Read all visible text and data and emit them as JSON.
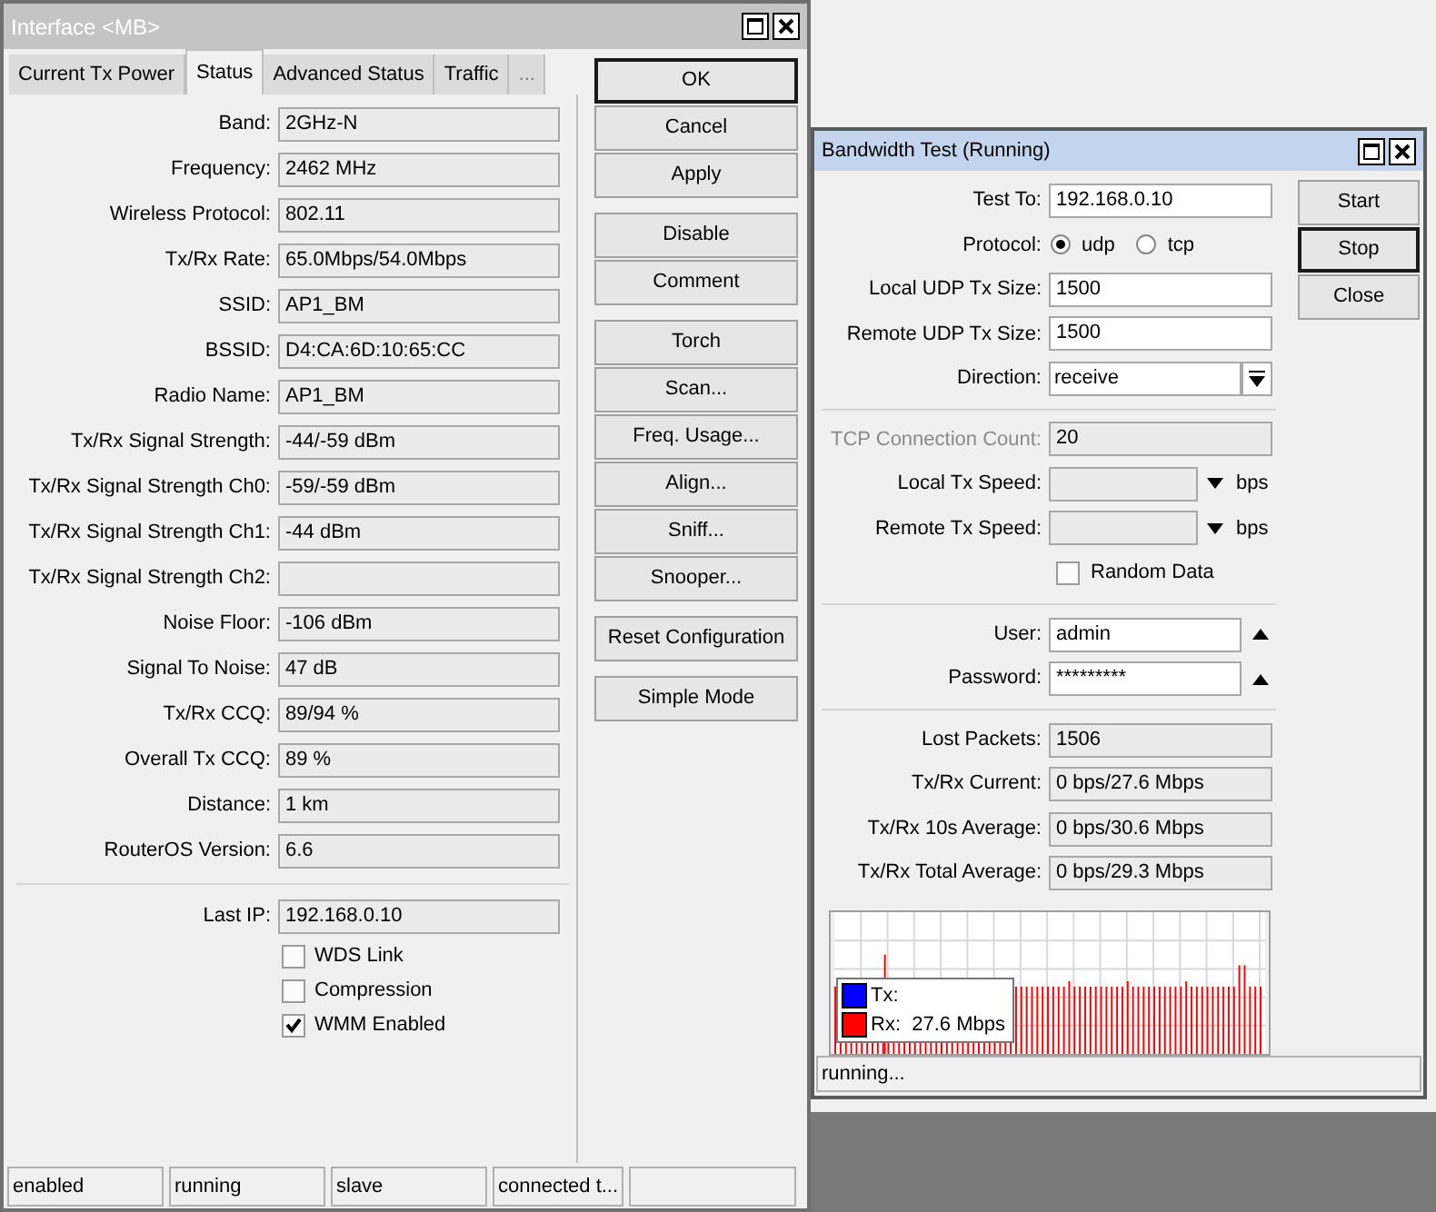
{
  "interface_window": {
    "title": "Interface <MB>",
    "tabs": [
      {
        "label": "Current Tx Power",
        "selected": false
      },
      {
        "label": "Status",
        "selected": true
      },
      {
        "label": "Advanced Status",
        "selected": false
      },
      {
        "label": "Traffic",
        "selected": false
      },
      {
        "label": "...",
        "selected": false
      }
    ],
    "fields": [
      {
        "label": "Band:",
        "value": "2GHz-N"
      },
      {
        "label": "Frequency:",
        "value": "2462 MHz"
      },
      {
        "label": "Wireless Protocol:",
        "value": "802.11"
      },
      {
        "label": "Tx/Rx Rate:",
        "value": "65.0Mbps/54.0Mbps"
      },
      {
        "label": "SSID:",
        "value": "AP1_BM"
      },
      {
        "label": "BSSID:",
        "value": "D4:CA:6D:10:65:CC"
      },
      {
        "label": "Radio Name:",
        "value": "AP1_BM"
      },
      {
        "label": "Tx/Rx Signal Strength:",
        "value": "-44/-59 dBm"
      },
      {
        "label": "Tx/Rx Signal Strength Ch0:",
        "value": "-59/-59 dBm"
      },
      {
        "label": "Tx/Rx Signal Strength Ch1:",
        "value": "-44 dBm"
      },
      {
        "label": "Tx/Rx Signal Strength Ch2:"
      },
      {
        "label": "Noise Floor:",
        "value": "-106 dBm"
      },
      {
        "label": "Signal To Noise:",
        "value": "47 dB"
      },
      {
        "label": "Tx/Rx CCQ:",
        "value": "89/94 %"
      },
      {
        "label": "Overall Tx CCQ:",
        "value": "89 %"
      },
      {
        "label": "Distance:",
        "value": "1 km"
      },
      {
        "label": "RouterOS Version:",
        "value": "6.6"
      }
    ],
    "last_ip": {
      "label": "Last IP:",
      "value": "192.168.0.10"
    },
    "checkboxes": [
      {
        "label": "WDS Link",
        "checked": false
      },
      {
        "label": "Compression",
        "checked": false
      },
      {
        "label": "WMM Enabled",
        "checked": true
      }
    ],
    "button_groups": [
      [
        {
          "label": "OK",
          "default": true
        },
        {
          "label": "Cancel",
          "default": false
        },
        {
          "label": "Apply",
          "default": false
        }
      ],
      [
        {
          "label": "Disable",
          "default": false
        },
        {
          "label": "Comment",
          "default": false
        }
      ],
      [
        {
          "label": "Torch",
          "default": false
        },
        {
          "label": "Scan...",
          "default": false
        },
        {
          "label": "Freq. Usage...",
          "default": false
        },
        {
          "label": "Align...",
          "default": false
        },
        {
          "label": "Sniff...",
          "default": false
        },
        {
          "label": "Snooper...",
          "default": false
        }
      ],
      [
        {
          "label": "Reset Configuration",
          "default": false
        }
      ],
      [
        {
          "label": "Simple Mode",
          "default": false
        }
      ]
    ],
    "status_bar": [
      "enabled",
      "running",
      "slave",
      "connected t..."
    ]
  },
  "bandwidth_window": {
    "title": "Bandwidth Test (Running)",
    "groups": [
      [
        {
          "kind": "input",
          "label": "Test To:",
          "value": "192.168.0.10"
        },
        {
          "kind": "radio",
          "label": "Protocol:",
          "options": [
            {
              "label": "udp",
              "selected": true
            },
            {
              "label": "tcp",
              "selected": false
            }
          ]
        },
        {
          "kind": "input",
          "label": "Local UDP Tx Size:",
          "value": "1500"
        },
        {
          "kind": "input",
          "label": "Remote UDP Tx Size:",
          "value": "1500"
        },
        {
          "kind": "combo",
          "label": "Direction:",
          "value": "receive"
        }
      ],
      [
        {
          "kind": "readonly",
          "label": "TCP Connection Count:",
          "value": "20",
          "disabled": true
        },
        {
          "kind": "speed",
          "label": "Local Tx Speed:",
          "unit": "bps"
        },
        {
          "kind": "speed",
          "label": "Remote Tx Speed:",
          "unit": "bps"
        },
        {
          "kind": "checkbox",
          "label": "Random Data",
          "checked": false
        }
      ],
      [
        {
          "kind": "secret",
          "label": "User:",
          "value": "admin"
        },
        {
          "kind": "secret",
          "label": "Password:",
          "value": "*********"
        }
      ],
      [
        {
          "kind": "readonly",
          "label": "Lost Packets:",
          "value": "1506",
          "disabled": false
        },
        {
          "kind": "readonly",
          "label": "Tx/Rx Current:",
          "value": "0 bps/27.6 Mbps",
          "disabled": false
        },
        {
          "kind": "readonly",
          "label": "Tx/Rx 10s Average:",
          "value": "0 bps/30.6 Mbps",
          "disabled": false
        },
        {
          "kind": "readonly",
          "label": "Tx/Rx Total Average:",
          "value": "0 bps/29.3 Mbps",
          "disabled": false
        }
      ]
    ],
    "legend": [
      {
        "label": "Tx:",
        "color": "#0000ff"
      },
      {
        "label": "Rx:  27.6 Mbps",
        "color": "#ff0000"
      }
    ],
    "buttons": [
      {
        "label": "Start",
        "default": false
      },
      {
        "label": "Stop",
        "default": true
      },
      {
        "label": "Close",
        "default": false
      }
    ],
    "status": "running..."
  }
}
